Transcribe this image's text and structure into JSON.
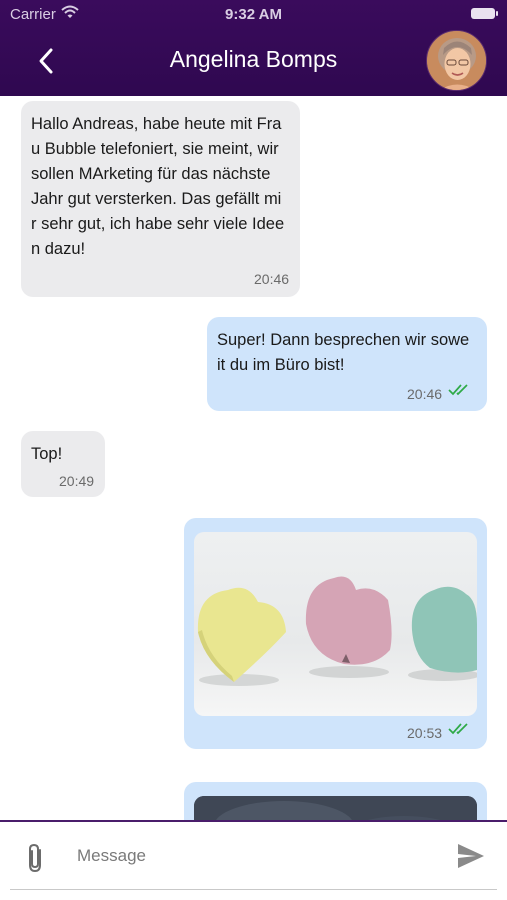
{
  "status_bar": {
    "carrier": "Carrier",
    "time": "9:32 AM"
  },
  "header": {
    "title": "Angelina Bomps",
    "back_icon": "chevron-left-icon",
    "background": "#36095a"
  },
  "messages": [
    {
      "direction": "incoming",
      "text": "Hallo Andreas, habe heute mit Fra u Bubble telefoniert, sie meint, wir sollen MArketing für das nächste Jahr gut versterken. Das gefällt mi r sehr gut, ich habe sehr viele Idee n dazu!",
      "lines": [
        "Hallo Andreas, habe heute mit Fra",
        "u Bubble telefoniert, sie meint, wir",
        "sollen MArketing für das nächste",
        "Jahr gut versterken. Das gefällt mi",
        "r sehr gut, ich habe sehr viele Idee",
        "n dazu!"
      ],
      "time": "20:46"
    },
    {
      "direction": "outgoing",
      "lines": [
        "Super! Dann besprechen wir sowe",
        "it du im Büro bist!"
      ],
      "time": "20:46",
      "status": "read"
    },
    {
      "direction": "incoming",
      "lines": [
        "Top!"
      ],
      "time": "20:49"
    },
    {
      "direction": "outgoing",
      "type": "image",
      "image": "pastel-hearts-photo",
      "time": "20:53",
      "status": "read"
    },
    {
      "direction": "outgoing",
      "type": "image",
      "image": "dark-photo"
    }
  ],
  "composer": {
    "placeholder": "Message",
    "attach_icon": "paperclip-icon",
    "send_icon": "send-icon"
  },
  "colors": {
    "incoming_bubble": "#ebebed",
    "outgoing_bubble": "#cfe4fb",
    "read_ticks": "#2eaa47"
  }
}
